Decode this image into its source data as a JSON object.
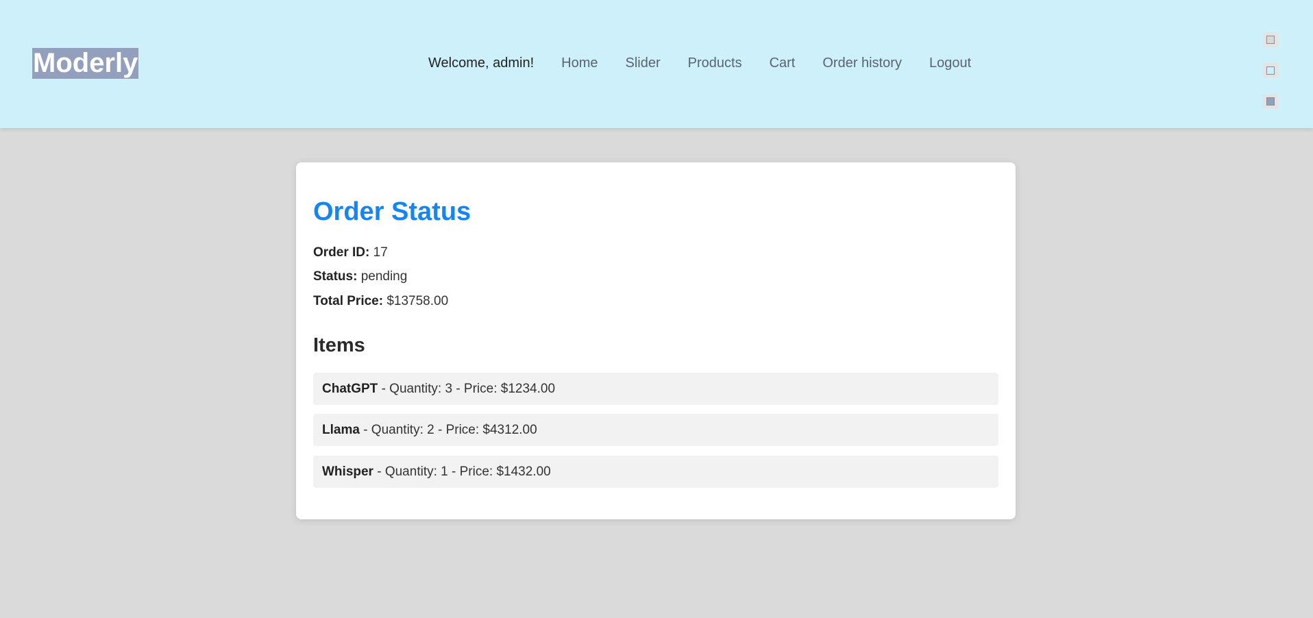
{
  "header": {
    "logo": "Moderly",
    "welcome": "Welcome, admin!",
    "nav": [
      "Home",
      "Slider",
      "Products",
      "Cart",
      "Order history",
      "Logout"
    ],
    "background_color": "#cdf0fb",
    "logo_background_color": "#929fbd"
  },
  "theme_switcher": {
    "options": [
      {
        "name": "grey",
        "color": "#d9d9d9"
      },
      {
        "name": "light-blue",
        "color": "#cdf0fb"
      },
      {
        "name": "slate",
        "color": "#929fbd"
      }
    ]
  },
  "order": {
    "title": "Order Status",
    "title_color": "#1485f5",
    "order_id_label": "Order ID:",
    "order_id": "17",
    "status_label": "Status:",
    "status": "pending",
    "total_label": "Total Price:",
    "total": "$13758.00",
    "items_heading": "Items",
    "items": [
      {
        "name": "ChatGPT",
        "details": "- Quantity: 3 - Price: $1234.00"
      },
      {
        "name": "Llama",
        "details": "- Quantity: 2 - Price: $4312.00"
      },
      {
        "name": "Whisper",
        "details": "- Quantity: 1 - Price: $1432.00"
      }
    ]
  }
}
